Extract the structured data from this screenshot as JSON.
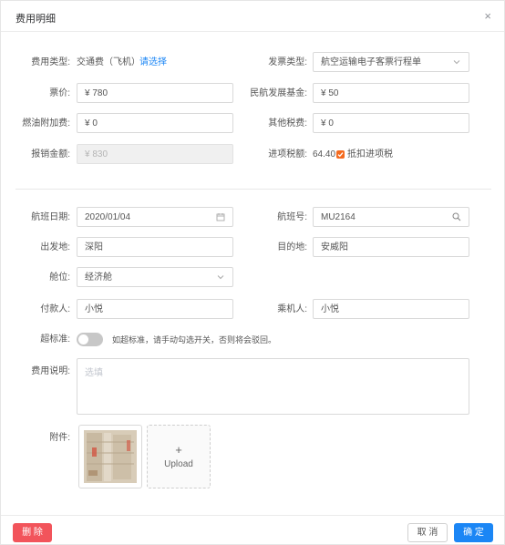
{
  "dialog": {
    "title": "费用明细",
    "close_symbol": "×"
  },
  "expense": {
    "type_label": "费用类型:",
    "type_value": "交通费（飞机）",
    "type_link": "请选择",
    "invoice_type_label": "发票类型:",
    "invoice_type_value": "航空运输电子客票行程单",
    "fare_label": "票价:",
    "fare_value": "¥ 780",
    "caac_label": "民航发展基金:",
    "caac_value": "¥ 50",
    "fuel_label": "燃油附加费:",
    "fuel_value": "¥ 0",
    "other_tax_label": "其他税费:",
    "other_tax_value": "¥ 0",
    "reimburse_label": "报销金额:",
    "reimburse_value": "¥ 830",
    "input_tax_label": "进项税额:",
    "input_tax_value": "64.40",
    "deduct_label": "抵扣进项税",
    "deduct_checked": true
  },
  "flight": {
    "date_label": "航班日期:",
    "date_value": "2020/01/04",
    "flight_no_label": "航班号:",
    "flight_no_value": "MU2164",
    "from_label": "出发地:",
    "from_value": "深阳",
    "to_label": "目的地:",
    "to_value": "安威阳",
    "cabin_label": "舱位:",
    "cabin_value": "经济舱",
    "payer_label": "付款人:",
    "payer_value": "小悦",
    "passenger_label": "乘机人:",
    "passenger_value": "小悦",
    "over_std_label": "超标准:",
    "over_std_on": false,
    "over_std_hint": "如超标准，请手动勾选开关，否则将会驳回。",
    "desc_label": "费用说明:",
    "desc_placeholder": "选填",
    "attach_label": "附件:",
    "upload_plus": "+",
    "upload_label": "Upload"
  },
  "footer": {
    "delete_label": "删 除",
    "cancel_label": "取 消",
    "confirm_label": "确 定"
  },
  "colors": {
    "primary": "#1b86f5",
    "danger": "#f2545b",
    "checkbox": "#f46a1f"
  }
}
